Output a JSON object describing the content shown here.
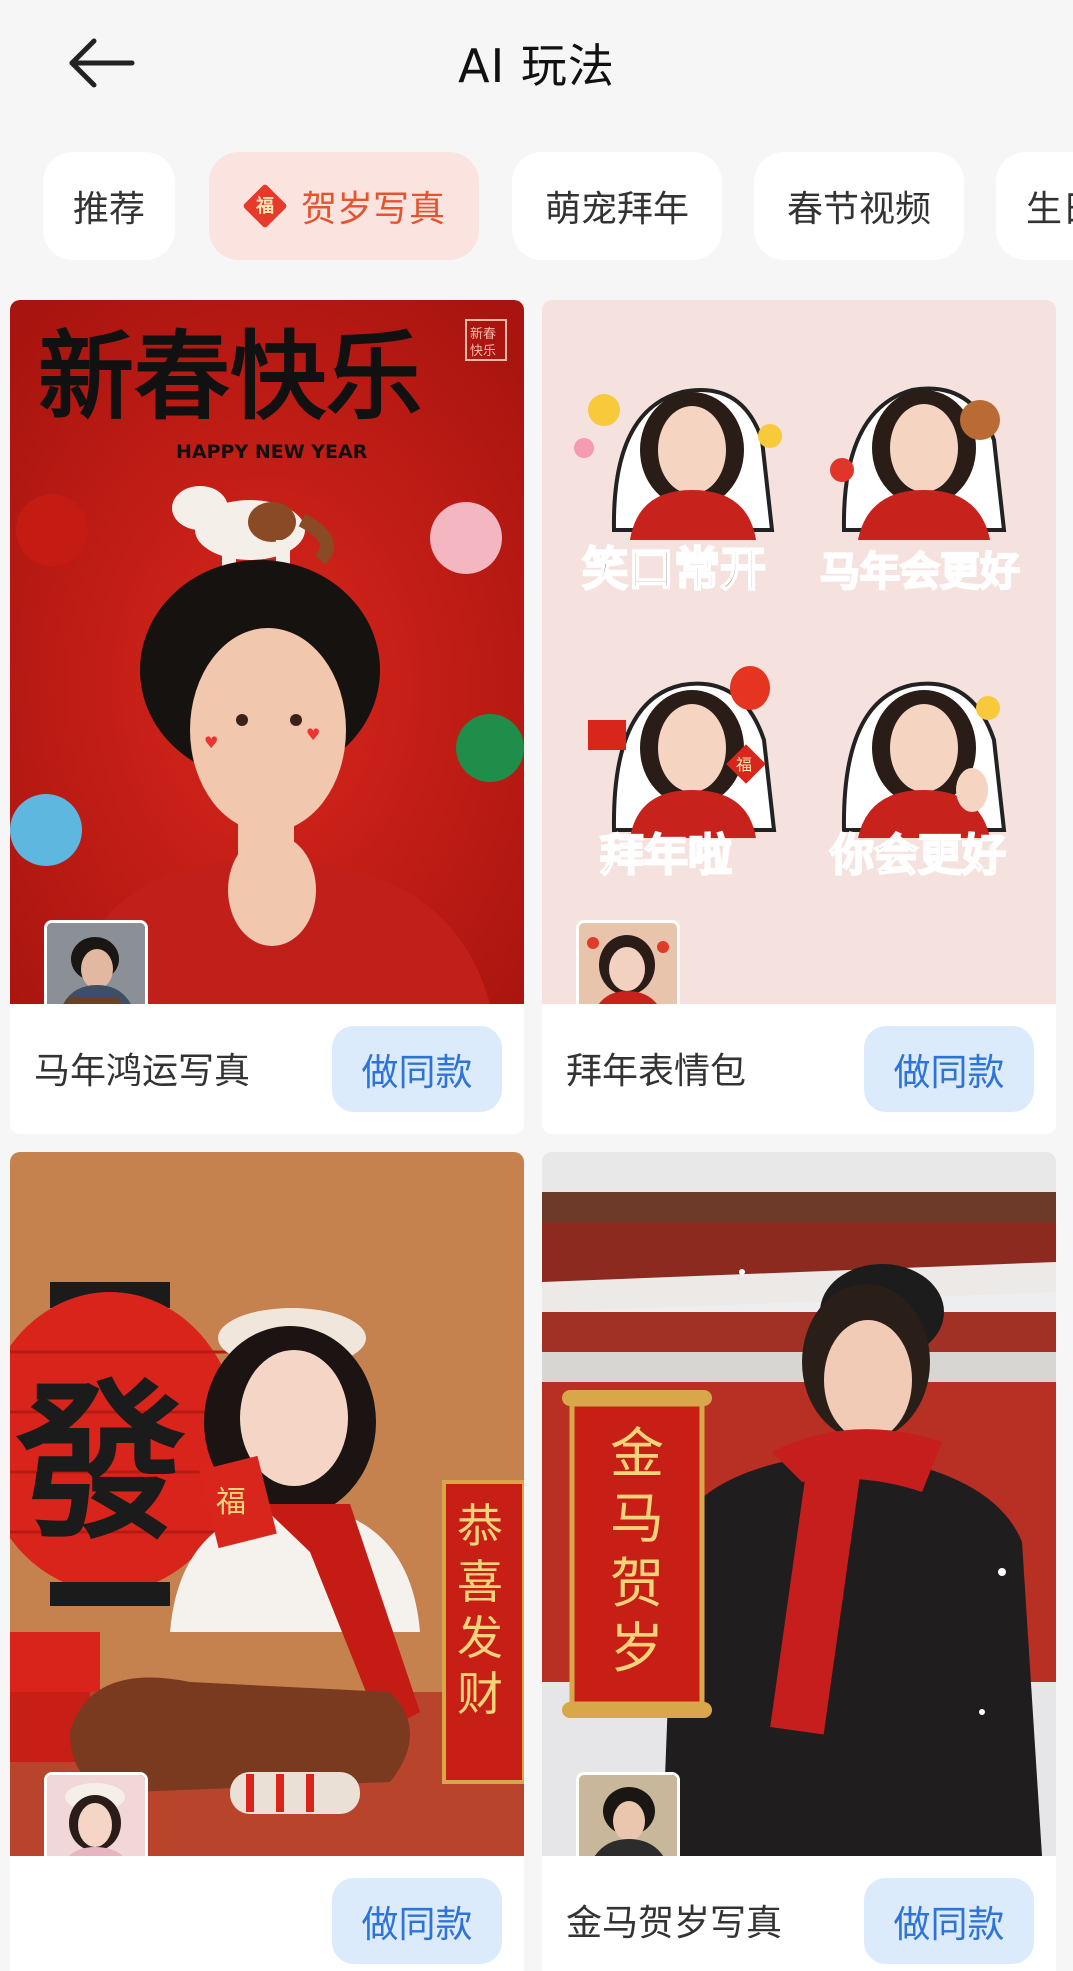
{
  "header": {
    "title": "AI 玩法",
    "back_icon": "arrow-left-icon"
  },
  "tabs": [
    {
      "label": "推荐",
      "active": false
    },
    {
      "label": "贺岁写真",
      "active": true,
      "icon": "fu-diamond-icon",
      "icon_char": "福"
    },
    {
      "label": "萌宠拜年",
      "active": false
    },
    {
      "label": "春节视频",
      "active": false
    },
    {
      "label": "生日",
      "active": false
    }
  ],
  "cards": [
    {
      "title": "马年鸿运写真",
      "button": "做同款",
      "image_text": {
        "headline": "新春快乐",
        "subline": "HAPPY NEW YEAR",
        "seal": "新春快乐"
      }
    },
    {
      "title": "拜年表情包",
      "button": "做同款",
      "image_text": {
        "stickers": [
          "笑口常开",
          "马年会更好",
          "拜年啦",
          "你会更好"
        ],
        "fu": "福"
      }
    },
    {
      "title": "",
      "button": "做同款",
      "image_text": {
        "lantern": "發",
        "fu": "福",
        "couplet": "恭喜发财"
      }
    },
    {
      "title": "金马贺岁写真",
      "button": "做同款",
      "image_text": {
        "scroll": "金马贺岁"
      }
    }
  ],
  "colors": {
    "accent": "#e4552f",
    "button_bg": "#dcebfb",
    "button_text": "#2e74d6",
    "tab_active_bg": "#fbe4df"
  }
}
